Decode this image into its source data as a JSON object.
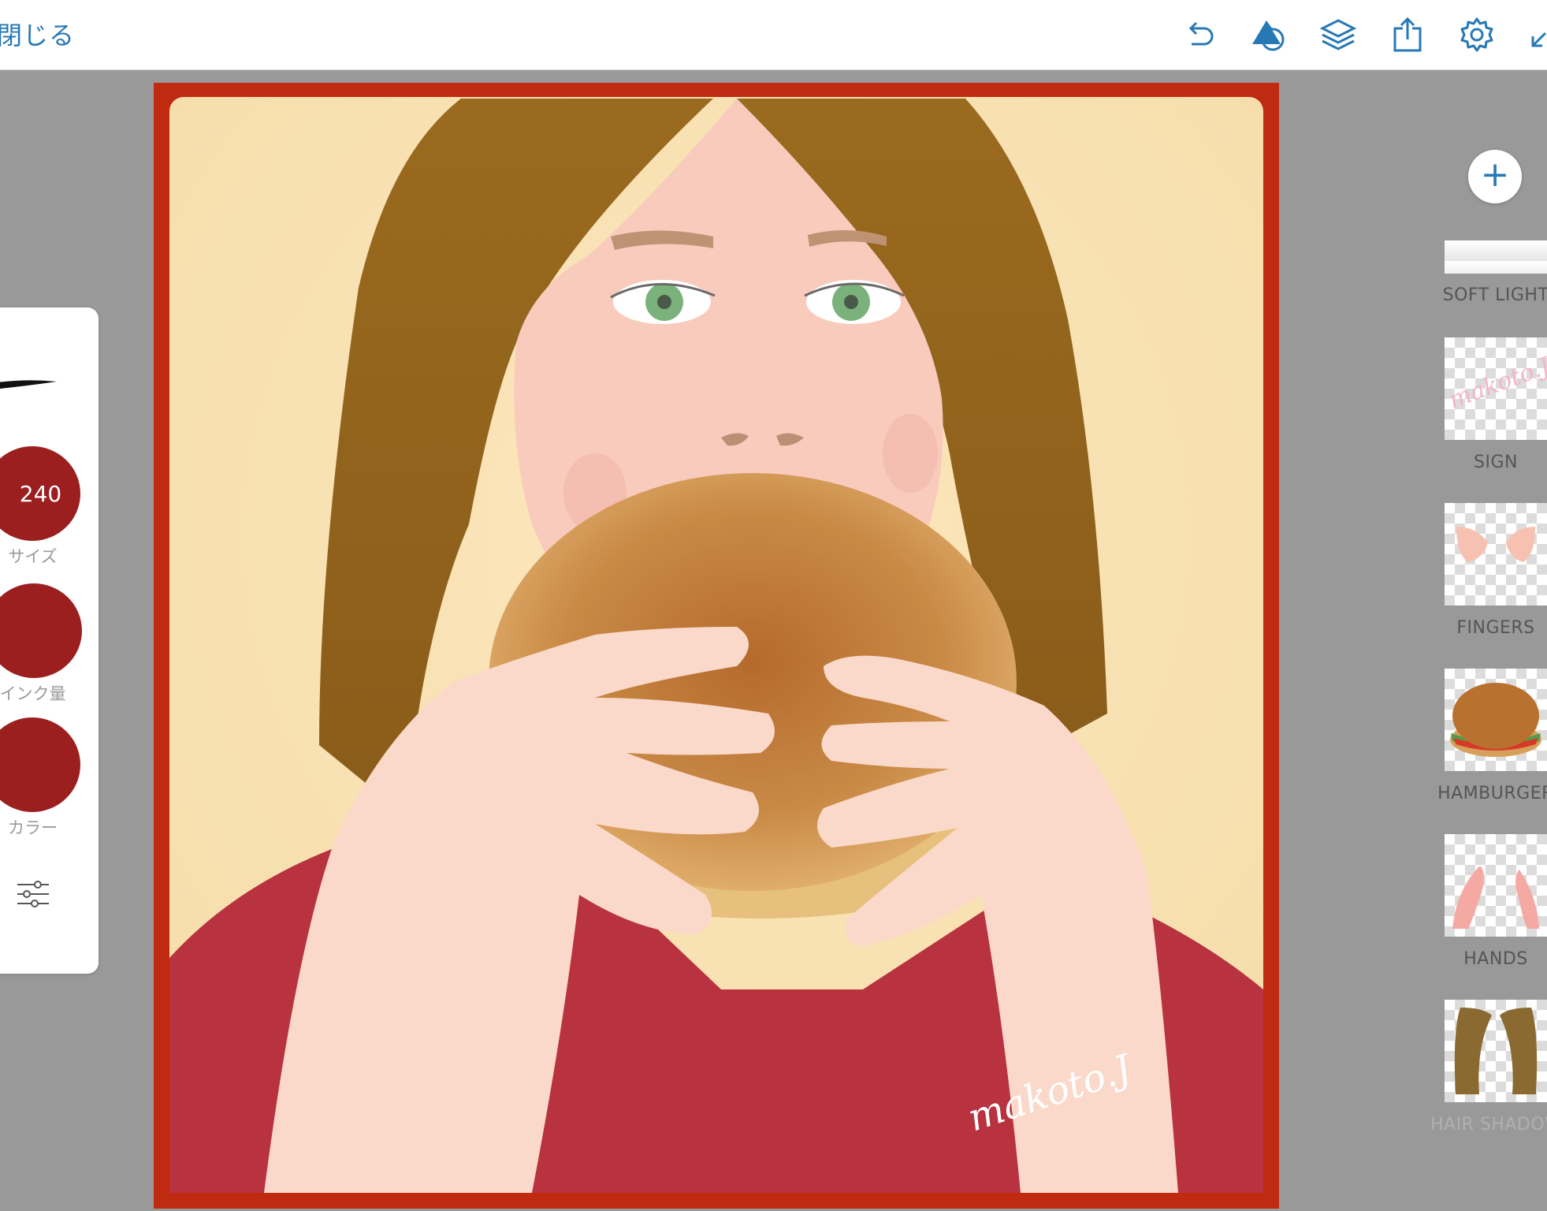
{
  "app": {
    "close_label": "閉じる",
    "toolbar_icons": [
      "undo-icon",
      "shape-tool-icon",
      "layers-icon",
      "share-icon",
      "settings-gear-icon",
      "collapse-arrow-icon"
    ],
    "accent_color": "#2779b5"
  },
  "brush_panel": {
    "size": {
      "value": "240",
      "label": "サイズ"
    },
    "ink": {
      "label": "インク量"
    },
    "color": {
      "label": "カラー",
      "value": "#9c1f20"
    },
    "settings_icon": "sliders-icon"
  },
  "layers": {
    "add_button": "+",
    "items": [
      {
        "name": "SOFT LIGHT"
      },
      {
        "name": "SIGN"
      },
      {
        "name": "FINGERS"
      },
      {
        "name": "HAMBURGER"
      },
      {
        "name": "HANDS"
      },
      {
        "name": "HAIR SHADOW"
      }
    ]
  },
  "canvas": {
    "signature": "makoto.J"
  }
}
